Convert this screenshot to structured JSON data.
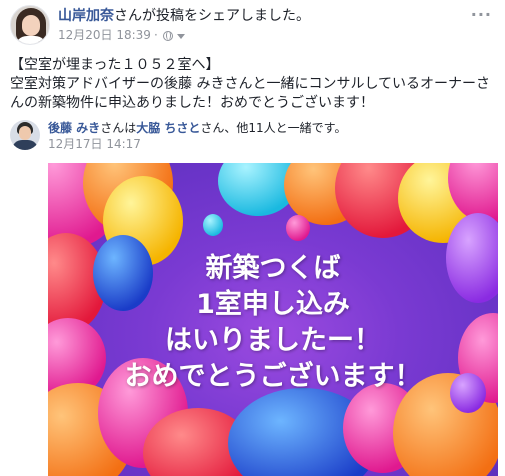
{
  "post": {
    "author": "山岸加奈",
    "action": "さんが投稿をシェアしました。",
    "timestamp": "12月20日 18:39",
    "separator": "·",
    "more": "···",
    "body_line1": "【空室が埋まった１０５２室へ】",
    "body_line2": "空室対策アドバイザーの後藤 みきさんと一緒にコンサルしているオーナーさ",
    "body_line3": "んの新築物件に申込ありました！おめでとうございます！"
  },
  "shared": {
    "author": "後藤 みき",
    "text_a": "さんは",
    "tagged": "大脇 ちさと",
    "text_b": "さん、他11人と一緒です。",
    "timestamp": "12月17日 14:17"
  },
  "image": {
    "line1": "新築つくば",
    "line2": "1室申し込み",
    "line3": "はいりましたー！",
    "line4": "おめでとうございます！"
  },
  "icons": {
    "privacy": "globe-icon",
    "menu": "chevron-down-icon",
    "options": "more-icon"
  },
  "colors": {
    "link": "#385898",
    "meta": "#90949c",
    "text": "#1d2129"
  }
}
